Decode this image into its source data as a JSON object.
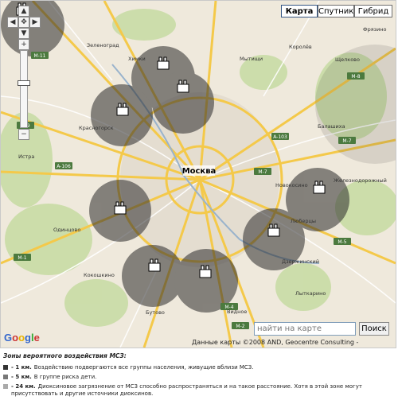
{
  "map": {
    "type_buttons": [
      "Карта",
      "Спутник",
      "Гибрид"
    ],
    "active_type": "Карта",
    "city_label": "Москва",
    "search_placeholder": "найти на карте",
    "search_button": "Поиск",
    "copyright": "Данные карты ©2008 AND, Geocentre Consulting -",
    "google_logo": "Google",
    "zoom_in": "+",
    "zoom_out": "−",
    "road_shields": [
      "M-11",
      "M-9",
      "A-106",
      "M-1",
      "A-103",
      "M-7",
      "M-7",
      "M-5",
      "M-4",
      "M-2",
      "M-8"
    ],
    "places": [
      "Химки",
      "Мытищи",
      "Щелково",
      "Королёв",
      "Красногорск",
      "Балашиха",
      "Одинцово",
      "Железнодорожный",
      "Люберцы",
      "Дзержинский",
      "Лыткарино",
      "Видное",
      "Бутово",
      "Истра",
      "Зеленоград",
      "Фрязино",
      "Новокосино",
      "Кокошкино"
    ]
  },
  "legend": {
    "title": "Зоны вероятного воздействия МСЗ:",
    "items": [
      {
        "distance": "- 1 км.",
        "text": "Воздействию подвергаются все группы населения, живущие вблизи МСЗ.",
        "color": "#333333"
      },
      {
        "distance": "- 5 км.",
        "text": "В группе риска дети.",
        "color": "#777777"
      },
      {
        "distance": "- 24 км.",
        "text": "Диоксиновое загрязнение от МСЗ способно распространяться и на такое расстояние. Хотя в этой зоне могут присутствовать и другие источники диоксинов.",
        "color": "#aaaaaa"
      }
    ]
  },
  "colors": {
    "map_background": "#efe9dc",
    "road_major": "#f4c94a",
    "road_outline": "#c49a2a",
    "zone_fill": "#2b2b2b"
  }
}
